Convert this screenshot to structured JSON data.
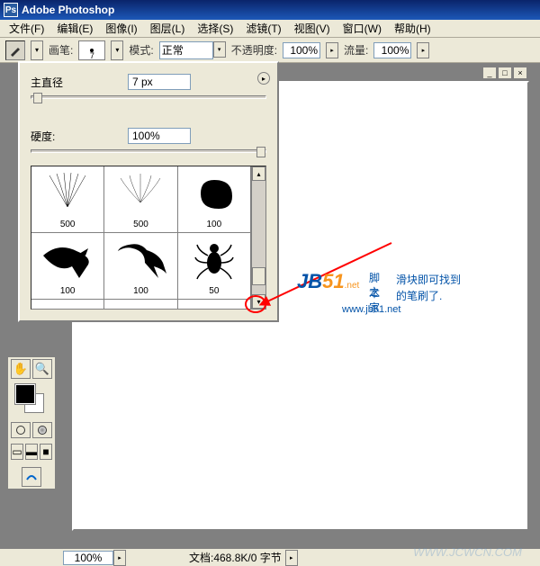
{
  "titlebar": {
    "app_name": "Adobe Photoshop"
  },
  "menu": {
    "file": "文件(F)",
    "edit": "编辑(E)",
    "image": "图像(I)",
    "layer": "图层(L)",
    "select": "选择(S)",
    "filter": "滤镜(T)",
    "view": "视图(V)",
    "window": "窗口(W)",
    "help": "帮助(H)"
  },
  "options": {
    "brush_label": "画笔:",
    "brush_size": "7",
    "mode_label": "模式:",
    "mode_value": "正常",
    "opacity_label": "不透明度:",
    "opacity_value": "100%",
    "flow_label": "流量:",
    "flow_value": "100%"
  },
  "brush_panel": {
    "diameter_label": "主直径",
    "diameter_value": "7 px",
    "hardness_label": "硬度:",
    "hardness_value": "100%",
    "brushes": [
      {
        "size": "500"
      },
      {
        "size": "500"
      },
      {
        "size": "100"
      },
      {
        "size": "100"
      },
      {
        "size": "100"
      },
      {
        "size": "50"
      },
      {
        "size": ""
      },
      {
        "size": ""
      },
      {
        "size": ""
      }
    ]
  },
  "status": {
    "zoom": "100%",
    "docinfo": "文档:468.8K/0 字节"
  },
  "annotation": {
    "logo_jb": "JB",
    "logo_51": "51",
    "logo_sub": "脚本",
    "line1": "滑块即可找到",
    "line2": "的笔刷了.",
    "url": "www.jb51.net",
    "dot_net": ".net",
    "zhijia": "之家"
  },
  "watermark": "WWW.JCWCN.COM"
}
